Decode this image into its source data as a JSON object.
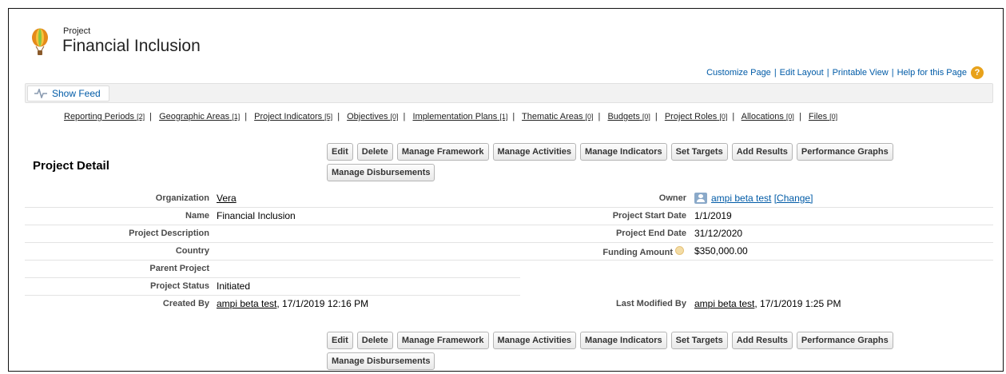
{
  "header": {
    "object_type": "Project",
    "title": "Financial Inclusion",
    "links": [
      "Customize Page",
      "Edit Layout",
      "Printable View",
      "Help for this Page"
    ],
    "separator": "|"
  },
  "feed": {
    "show_feed_label": "Show Feed"
  },
  "related_lists": [
    {
      "label": "Reporting Periods",
      "count": "[2]"
    },
    {
      "label": "Geographic Areas",
      "count": "[1]"
    },
    {
      "label": "Project Indicators",
      "count": "[5]"
    },
    {
      "label": "Objectives",
      "count": "[0]"
    },
    {
      "label": "Implementation Plans",
      "count": "[1]"
    },
    {
      "label": "Thematic Areas",
      "count": "[0]"
    },
    {
      "label": "Budgets",
      "count": "[0]"
    },
    {
      "label": "Project Roles",
      "count": "[0]"
    },
    {
      "label": "Allocations",
      "count": "[0]"
    },
    {
      "label": "Files",
      "count": "[0]"
    }
  ],
  "detail": {
    "section_title": "Project Detail",
    "buttons": [
      "Edit",
      "Delete",
      "Manage Framework",
      "Manage Activities",
      "Manage Indicators",
      "Set Targets",
      "Add Results",
      "Performance Graphs",
      "Manage Disbursements"
    ],
    "fields": {
      "organization": {
        "label": "Organization",
        "value": "Vera"
      },
      "name": {
        "label": "Name",
        "value": "Financial Inclusion"
      },
      "description": {
        "label": "Project Description",
        "value": ""
      },
      "country": {
        "label": "Country",
        "value": ""
      },
      "parent_project": {
        "label": "Parent Project",
        "value": ""
      },
      "status": {
        "label": "Project Status",
        "value": "Initiated"
      },
      "created_by": {
        "label": "Created By",
        "user": "ampi beta test",
        "date": ", 17/1/2019 12:16 PM"
      },
      "owner": {
        "label": "Owner",
        "value": "ampi beta test",
        "change": "[Change]"
      },
      "start_date": {
        "label": "Project Start Date",
        "value": "1/1/2019"
      },
      "end_date": {
        "label": "Project End Date",
        "value": "31/12/2020"
      },
      "funding_amount": {
        "label": "Funding Amount",
        "value": "$350,000.00"
      },
      "last_modified_by": {
        "label": "Last Modified By",
        "user": "ampi beta test",
        "date": ", 17/1/2019 1:25 PM"
      }
    }
  },
  "colors": {
    "link": "#015ba7",
    "help_icon": "#e8a21b",
    "icon_balloon": "#e58a1a"
  },
  "icons": {
    "header": "balloon-icon",
    "feed": "pulse-icon",
    "help": "help-icon",
    "owner": "user-icon",
    "funding_info": "info-icon"
  }
}
